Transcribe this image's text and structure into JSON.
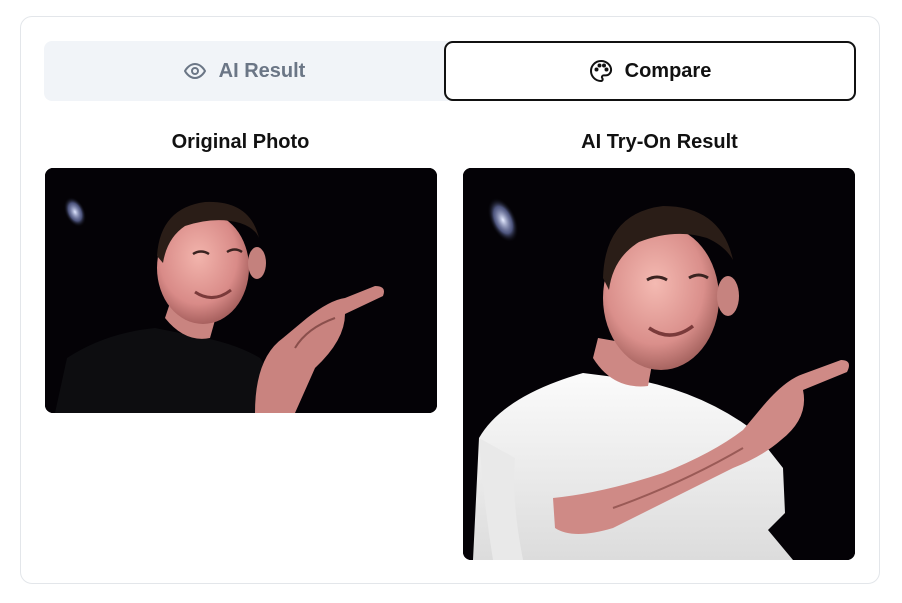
{
  "tabs": {
    "ai_result": {
      "label": "AI Result",
      "icon": "eye-icon"
    },
    "compare": {
      "label": "Compare",
      "icon": "palette-icon",
      "active": true
    }
  },
  "panels": {
    "original": {
      "title": "Original Photo",
      "image_desc": "man-in-black-shirt-pointing"
    },
    "result": {
      "title": "AI Try-On Result",
      "image_desc": "man-in-white-tshirt-pointing"
    }
  },
  "colors": {
    "tab_bg": "#f1f4f8",
    "active_border": "#111111",
    "inactive_text": "#6b7686",
    "photo_bg": "#040206"
  }
}
